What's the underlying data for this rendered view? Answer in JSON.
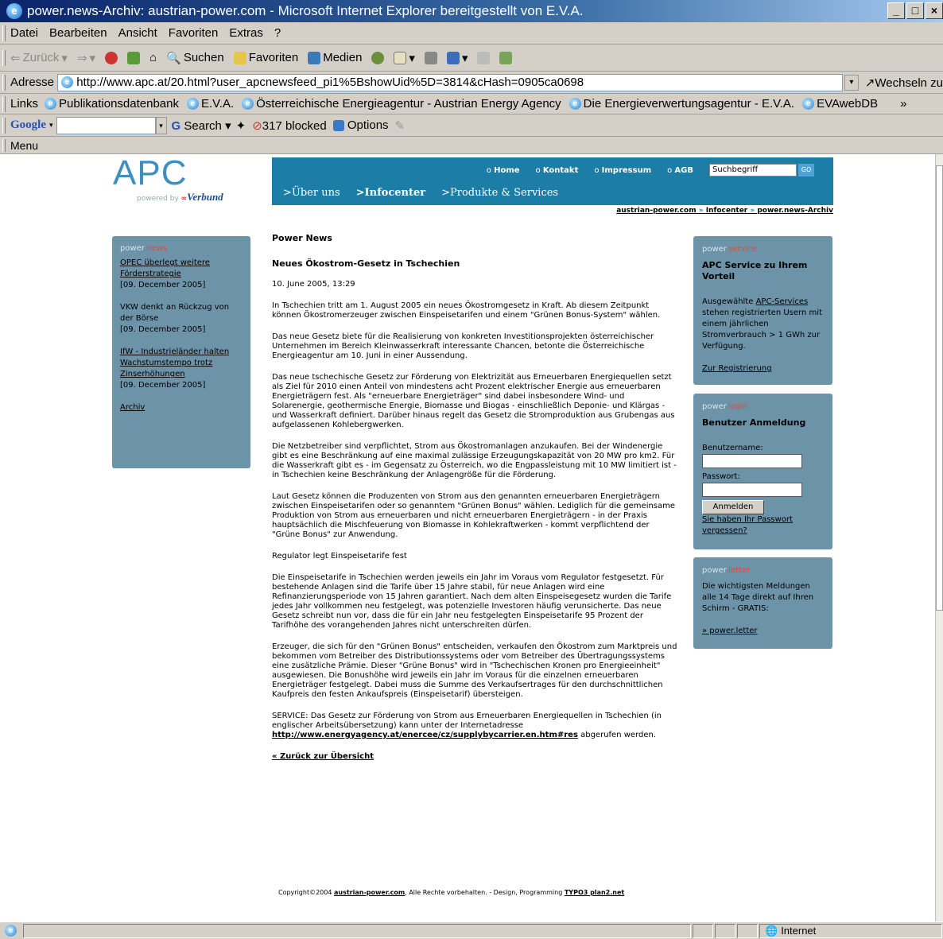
{
  "window": {
    "title": "power.news-Archiv: austrian-power.com - Microsoft Internet Explorer bereitgestellt von E.V.A.",
    "controls": [
      "_",
      "□",
      "×"
    ]
  },
  "menubar": {
    "items": [
      "Datei",
      "Bearbeiten",
      "Ansicht",
      "Favoriten",
      "Extras",
      "?"
    ]
  },
  "toolbar": {
    "back": "Zurück",
    "search": "Suchen",
    "favorites": "Favoriten",
    "media": "Medien"
  },
  "address": {
    "label": "Adresse",
    "url": "http://www.apc.at/20.html?user_apcnewsfeed_pi1%5BshowUid%5D=3814&cHash=0905ca0698",
    "go": "Wechseln zu"
  },
  "links": {
    "label": "Links",
    "items": [
      "Publikationsdatenbank",
      "E.V.A.",
      "Österreichische Energieagentur - Austrian Energy Agency",
      "Die Energieverwertungsagentur - E.V.A.",
      "EVAwebDB"
    ]
  },
  "googlebar": {
    "brand": "Google",
    "search": "Search",
    "blocked": "317 blocked",
    "options": "Options"
  },
  "menu2": {
    "label": "Menu"
  },
  "site": {
    "logo": {
      "text": "APC",
      "powered": "powered by",
      "partner": "Verbund"
    },
    "topnav": [
      "Home",
      "Kontakt",
      "Impressum",
      "AGB"
    ],
    "search_placeholder": "Suchbegriff",
    "search_go": "GO",
    "mainnav": [
      "Über uns",
      "Infocenter",
      "Produkte & Services"
    ],
    "breadcrumb": [
      "austrian-power.com",
      "Infocenter",
      "power.news-Archiv"
    ],
    "breadcrumb_sep": "»"
  },
  "leftbox": {
    "title_a": "power",
    "title_b": ".news",
    "items": [
      {
        "link": "OPEC überlegt weitere Förderstrategie",
        "date": "[09. December 2005]"
      },
      {
        "link": "",
        "text": "VKW denkt an Rückzug von der Börse",
        "date": "[09. December 2005]"
      },
      {
        "link": "IfW - Industrieländer halten Wachstumstempo trotz Zinserhöhungen",
        "date": "[09. December 2005]"
      }
    ],
    "archive": "Archiv"
  },
  "article": {
    "section": "Power News",
    "headline": "Neues Ökostrom-Gesetz in Tschechien",
    "date": "10. June 2005, 13:29",
    "paragraphs": [
      "In Tschechien tritt am 1. August 2005 ein neues Ökostromgesetz in Kraft. Ab diesem Zeitpunkt können Ökostromerzeuger zwischen Einspeisetarifen und einem \"Grünen Bonus-System\" wählen.",
      "Das neue Gesetz biete für die Realisierung von konkreten Investitionsprojekten österreichischer Unternehmen im Bereich Kleinwasserkraft interessante Chancen, betonte die Österreichische Energieagentur am 10. Juni in einer Aussendung.",
      "Das neue tschechische Gesetz zur Förderung von Elektrizität aus Erneuerbaren Energiequellen setzt als Ziel für 2010 einen Anteil von mindestens acht Prozent elektrischer Energie aus erneuerbaren Energieträgern fest. Als \"erneuerbare Energieträger\" sind dabei insbesondere Wind- und Solarenergie, geothermische Energie, Biomasse und Biogas - einschließlich Deponie- und Klärgas - und Wasserkraft definiert. Darüber hinaus regelt das Gesetz die Stromproduktion aus Grubengas aus aufgelassenen Kohlebergwerken.",
      "Die Netzbetreiber sind verpflichtet, Strom aus Ökostromanlagen anzukaufen. Bei der Windenergie gibt es eine Beschränkung auf eine maximal zulässige Erzeugungskapazität von 20 MW pro km2. Für die Wasserkraft gibt es - im Gegensatz zu Österreich, wo die Engpassleistung mit 10 MW limitiert ist - in Tschechien keine Beschränkung der Anlagengröße für die Förderung.",
      "Laut Gesetz können die Produzenten von Strom aus den genannten erneuerbaren Energieträgern zwischen Einspeisetarifen oder so genanntem \"Grünen Bonus\" wählen. Lediglich für die gemeinsame Produktion von Strom aus erneuerbaren und nicht erneuerbaren Energieträgern - in der Praxis hauptsächlich die Mischfeuerung von Biomasse in Kohlekraftwerken - kommt verpflichtend der \"Grüne Bonus\" zur Anwendung.",
      "Regulator legt Einspeisetarife fest",
      "Die Einspeisetarife in Tschechien werden jeweils ein Jahr im Voraus vom Regulator festgesetzt. Für bestehende Anlagen sind die Tarife über 15 Jahre stabil, für neue Anlagen wird eine Refinanzierungsperiode von 15 Jahren garantiert. Nach dem alten Einspeisegesetz wurden die Tarife jedes Jahr vollkommen neu festgelegt, was potenzielle Investoren häufig verunsicherte. Das neue Gesetz schreibt nun vor, dass die für ein Jahr neu festgelegten Einspeisetarife 95 Prozent der Tarifhöhe des vorangehenden Jahres nicht unterschreiten dürfen.",
      "Erzeuger, die sich für den \"Grünen Bonus\" entscheiden, verkaufen den Ökostrom zum Marktpreis und bekommen vom Betreiber des Distributionssystems oder vom Betreiber des Übertragungssystems eine zusätzliche Prämie. Dieser \"Grüne Bonus\" wird in \"Tschechischen Kronen pro Energieeinheit\" ausgewiesen. Die Bonushöhe wird jeweils ein Jahr im Voraus für die einzelnen erneuerbaren Energieträger festgelegt. Dabei muss die Summe des Verkaufsertrages für den durchschnittlichen Kaufpreis den festen Ankaufspreis (Einspeisetarif) übersteigen."
    ],
    "service_pre": "SERVICE: Das Gesetz zur Förderung von Strom aus Erneuerbaren Energiequellen in Tschechien (in englischer Arbeitsübersetzung) kann unter der Internetadresse",
    "service_link": "http://www.energyagency.at/enercee/cz/supplybycarrier.en.htm#res",
    "service_post": "abgerufen werden.",
    "back": "« Zurück zur Übersicht"
  },
  "service_box": {
    "title_a": "power",
    "title_b": ".service",
    "heading": "APC Service zu Ihrem Vorteil",
    "text_pre": "Ausgewählte",
    "text_link": "APC-Services",
    "text_post": "stehen registrierten Usern mit einem jährlichen Stromverbrauch > 1 GWh zur Verfügung.",
    "register": "Zur Registrierung"
  },
  "login_box": {
    "title_a": "power",
    "title_b": ".login",
    "heading": "Benutzer Anmeldung",
    "user_label": "Benutzername:",
    "pass_label": "Passwort:",
    "submit": "Anmelden",
    "forgot": "Sie haben Ihr Passwort vergessen?"
  },
  "letter_box": {
    "title_a": "power",
    "title_b": ".letter",
    "text": "Die wichtigsten Meldungen alle 14 Tage direkt auf Ihren Schirm - GRATIS:",
    "link": "» power.letter"
  },
  "footer": {
    "pre": "Copyright©2004",
    "site": "austrian-power.com",
    "mid": ", Alle Rechte vorbehalten. - Design, Programming",
    "credit": "TYPO3 plan2.net"
  },
  "status": {
    "zone": "Internet"
  },
  "colors": {
    "header": "#1c7ea6",
    "box": "#6c93a8",
    "accent": "#e8473d",
    "logo": "#3e8fc0"
  }
}
